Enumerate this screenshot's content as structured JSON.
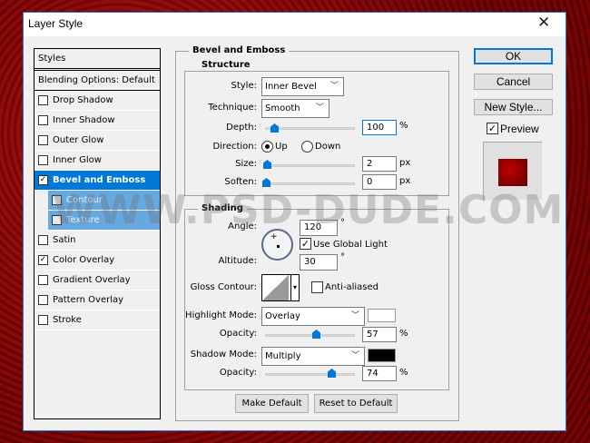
{
  "window": {
    "title": "Layer Style",
    "close_icon": "close-icon"
  },
  "styles_panel": {
    "header": "Styles",
    "blending": "Blending Options: Default",
    "items": [
      {
        "label": "Drop Shadow",
        "checked": false
      },
      {
        "label": "Inner Shadow",
        "checked": false
      },
      {
        "label": "Outer Glow",
        "checked": false
      },
      {
        "label": "Inner Glow",
        "checked": false
      },
      {
        "label": "Bevel and Emboss",
        "checked": true,
        "selected": true
      },
      {
        "label": "Contour",
        "checked": false,
        "sub": true
      },
      {
        "label": "Texture",
        "checked": true,
        "sub": true
      },
      {
        "label": "Satin",
        "checked": false
      },
      {
        "label": "Color Overlay",
        "checked": true
      },
      {
        "label": "Gradient Overlay",
        "checked": false
      },
      {
        "label": "Pattern Overlay",
        "checked": false
      },
      {
        "label": "Stroke",
        "checked": false
      }
    ]
  },
  "bevel": {
    "title": "Bevel and Emboss",
    "structure": {
      "title": "Structure",
      "style_label": "Style:",
      "style_value": "Inner Bevel",
      "technique_label": "Technique:",
      "technique_value": "Smooth",
      "depth_label": "Depth:",
      "depth_value": "100",
      "depth_unit": "%",
      "depth_slider": 100,
      "direction_label": "Direction:",
      "up_label": "Up",
      "down_label": "Down",
      "direction": "Up",
      "size_label": "Size:",
      "size_value": "2",
      "size_unit": "px",
      "soften_label": "Soften:",
      "soften_value": "0",
      "soften_unit": "px"
    },
    "shading": {
      "title": "Shading",
      "angle_label": "Angle:",
      "angle_value": "120",
      "angle_unit": "°",
      "global_light_label": "Use Global Light",
      "global_light": true,
      "altitude_label": "Altitude:",
      "altitude_value": "30",
      "altitude_unit": "°",
      "gloss_label": "Gloss Contour:",
      "anti_aliased_label": "Anti-aliased",
      "anti_aliased": false,
      "highlight_label": "Highlight Mode:",
      "highlight_mode": "Overlay",
      "highlight_color": "#ffffff",
      "highlight_opacity_label": "Opacity:",
      "highlight_opacity": "57",
      "highlight_unit": "%",
      "shadow_label": "Shadow Mode:",
      "shadow_mode": "Multiply",
      "shadow_color": "#000000",
      "shadow_opacity_label": "Opacity:",
      "shadow_opacity": "74",
      "shadow_unit": "%"
    },
    "make_default": "Make Default",
    "reset_default": "Reset to Default"
  },
  "actions": {
    "ok": "OK",
    "cancel": "Cancel",
    "new_style": "New Style...",
    "preview_label": "Preview",
    "preview": true
  },
  "watermark": "WWW.PSD-DUDE.COM",
  "colors": {
    "accent": "#0078d7",
    "preview_red": "#a00000"
  }
}
